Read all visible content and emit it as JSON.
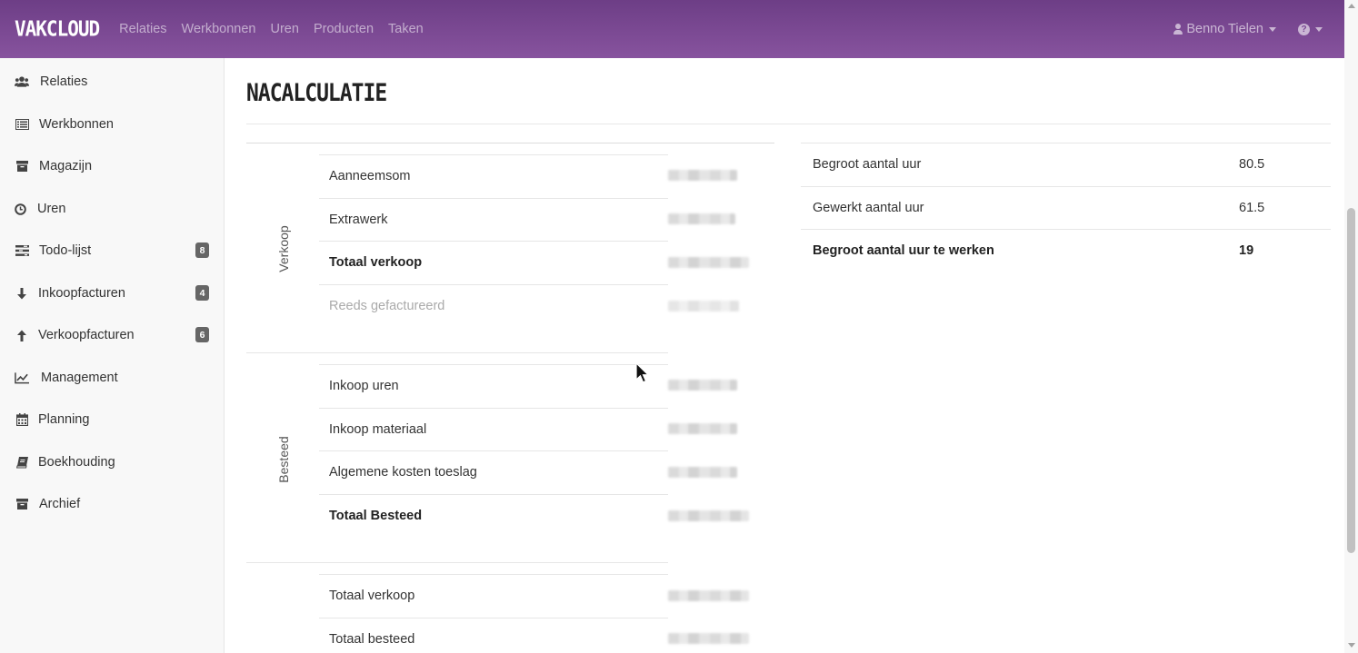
{
  "navbar": {
    "brand": "VAKCLOUD",
    "links": [
      "Relaties",
      "Werkbonnen",
      "Uren",
      "Producten",
      "Taken"
    ],
    "user_name": "Benno Tielen",
    "help_symbol": "?"
  },
  "sidebar": {
    "items": [
      {
        "label": "Relaties",
        "icon": "users-icon"
      },
      {
        "label": "Werkbonnen",
        "icon": "list-icon"
      },
      {
        "label": "Magazijn",
        "icon": "archive-icon"
      },
      {
        "label": "Uren",
        "icon": "clock-icon"
      },
      {
        "label": "Todo-lijst",
        "icon": "tasks-icon",
        "badge": "8"
      },
      {
        "label": "Inkoopfacturen",
        "icon": "arrow-down-icon",
        "badge": "4"
      },
      {
        "label": "Verkoopfacturen",
        "icon": "arrow-up-icon",
        "badge": "6"
      },
      {
        "label": "Management",
        "icon": "chart-line-icon"
      },
      {
        "label": "Planning",
        "icon": "calendar-icon"
      },
      {
        "label": "Boekhouding",
        "icon": "book-icon"
      },
      {
        "label": "Archief",
        "icon": "archive-icon"
      }
    ]
  },
  "main": {
    "title": "NACALCULATIE",
    "groups": [
      {
        "label": "Verkoop",
        "rows": [
          "Aanneemsom",
          "Extrawerk",
          "Totaal verkoop",
          "Reeds gefactureerd"
        ]
      },
      {
        "label": "Besteed",
        "rows": [
          "Inkoop uren",
          "Inkoop materiaal",
          "Algemene kosten toeslag",
          "Totaal Besteed"
        ]
      },
      {
        "label": "",
        "rows": [
          "Totaal verkoop",
          "Totaal besteed"
        ]
      }
    ],
    "hours": [
      {
        "label": "Begroot aantal uur",
        "value": "80.5"
      },
      {
        "label": "Gewerkt aantal uur",
        "value": "61.5"
      },
      {
        "label": "Begroot aantal uur te werken",
        "value": "19"
      }
    ]
  },
  "colors": {
    "navbar_top": "#6d3e86",
    "navbar_bottom": "#87539e",
    "badge": "#666666",
    "sidebar_bg": "#f8f8f8"
  }
}
